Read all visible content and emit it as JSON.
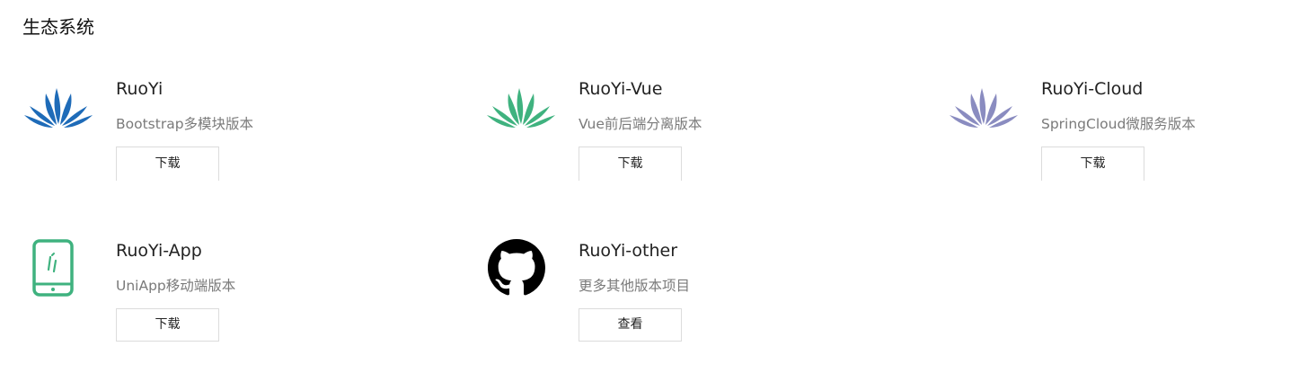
{
  "section": {
    "title": "生态系统"
  },
  "projects": [
    {
      "name": "RuoYi",
      "description": "Bootstrap多模块版本",
      "button_label": "下载",
      "icon": "lotus-blue-icon",
      "icon_color": "#1e6bb8"
    },
    {
      "name": "RuoYi-Vue",
      "description": "Vue前后端分离版本",
      "button_label": "下载",
      "icon": "lotus-green-icon",
      "icon_color": "#3fb27f"
    },
    {
      "name": "RuoYi-Cloud",
      "description": "SpringCloud微服务版本",
      "button_label": "下载",
      "icon": "lotus-purple-icon",
      "icon_color": "#8a8cc0"
    },
    {
      "name": "RuoYi-App",
      "description": "UniApp移动端版本",
      "button_label": "下载",
      "icon": "mobile-phone-icon",
      "icon_color": "#3fb27f"
    },
    {
      "name": "RuoYi-other",
      "description": "更多其他版本项目",
      "button_label": "查看",
      "icon": "github-icon",
      "icon_color": "#000000"
    }
  ]
}
